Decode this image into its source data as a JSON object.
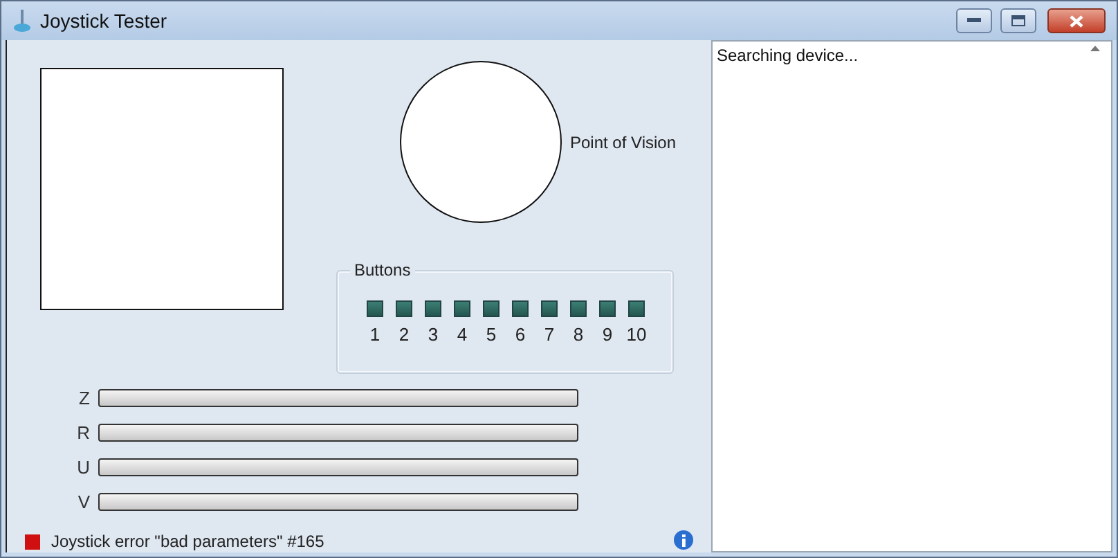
{
  "window": {
    "title": "Joystick Tester"
  },
  "point_of_vision": {
    "label": "Point of Vision"
  },
  "buttons": {
    "title": "Buttons",
    "items": [
      {
        "label": "1",
        "pressed": false
      },
      {
        "label": "2",
        "pressed": false
      },
      {
        "label": "3",
        "pressed": false
      },
      {
        "label": "4",
        "pressed": false
      },
      {
        "label": "5",
        "pressed": false
      },
      {
        "label": "6",
        "pressed": false
      },
      {
        "label": "7",
        "pressed": false
      },
      {
        "label": "8",
        "pressed": false
      },
      {
        "label": "9",
        "pressed": false
      },
      {
        "label": "10",
        "pressed": false
      }
    ]
  },
  "axes": [
    {
      "label": "Z",
      "level": 0
    },
    {
      "label": "R",
      "level": 0
    },
    {
      "label": "U",
      "level": 0
    },
    {
      "label": "V",
      "level": 0
    }
  ],
  "status": {
    "text": "Joystick error \"bad parameters\" #165",
    "color": "#d01010"
  },
  "log": {
    "text": "Searching device..."
  }
}
